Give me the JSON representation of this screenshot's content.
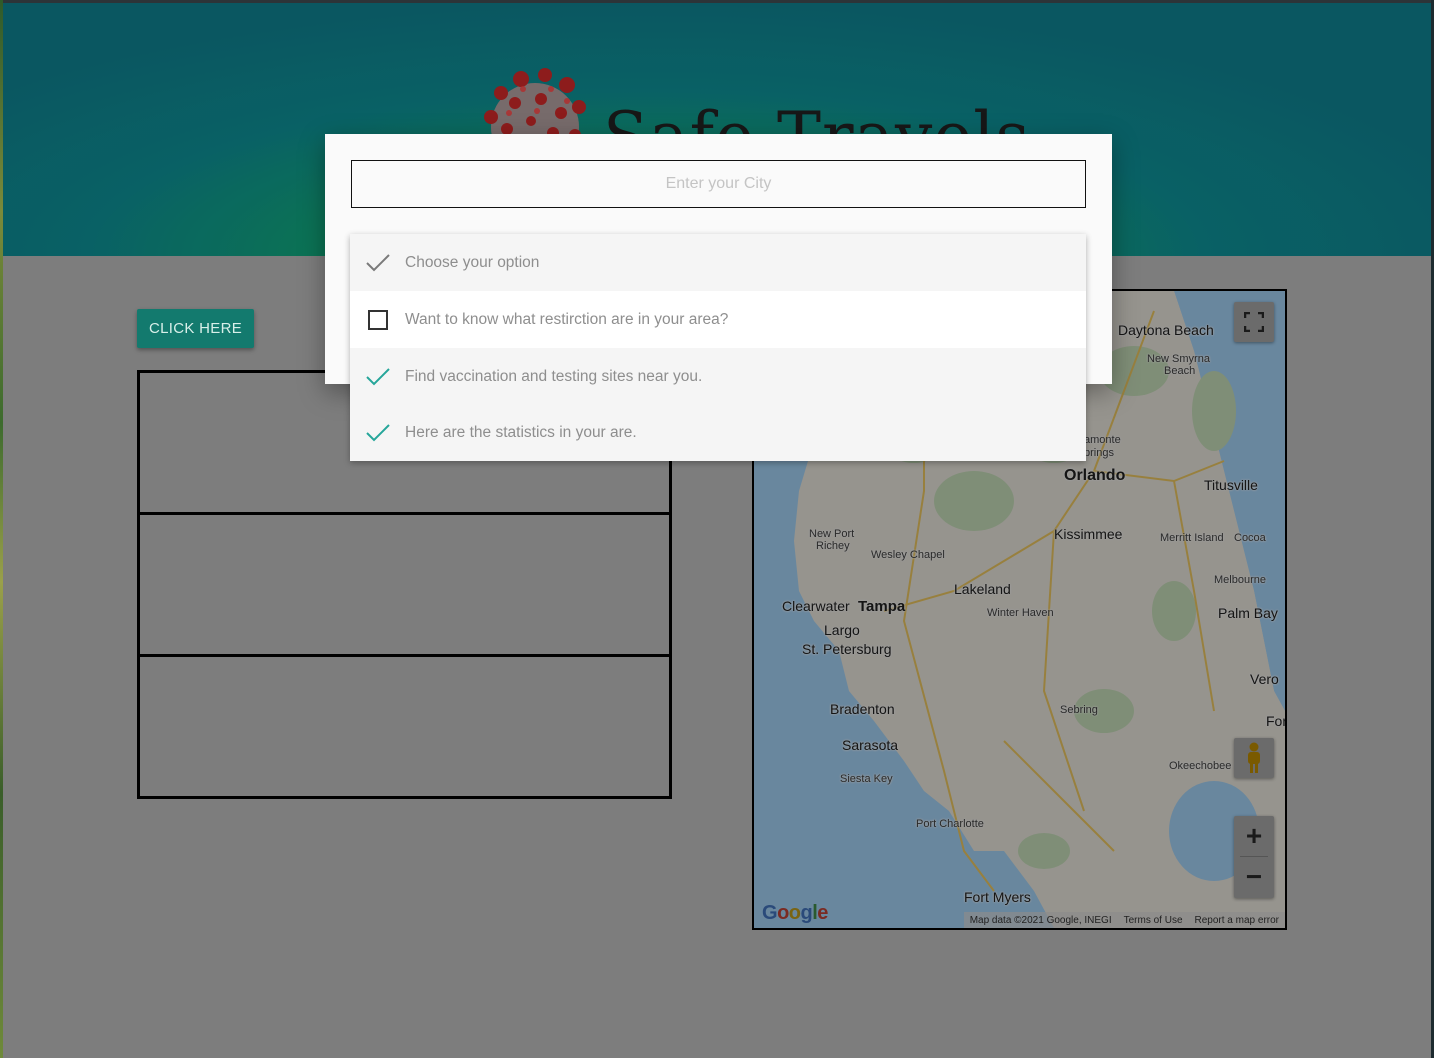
{
  "header": {
    "title": "Safe Travels",
    "logo": "coronavirus-image"
  },
  "main": {
    "click_button_label": "CLICK HERE",
    "info_boxes": [
      "",
      "",
      ""
    ]
  },
  "modal": {
    "city_input": {
      "placeholder": "Enter your City",
      "value": ""
    },
    "dropdown": {
      "options": [
        {
          "label": "Choose your option",
          "state": "selected-header",
          "icon": "checkmark-icon"
        },
        {
          "label": "Want to know what restirction are in your area?",
          "state": "unchecked",
          "icon": "checkbox-icon"
        },
        {
          "label": "Find vaccination and testing sites near you.",
          "state": "checked",
          "icon": "checkmark-icon"
        },
        {
          "label": "Here are the statistics in your are.",
          "state": "checked",
          "icon": "checkmark-icon"
        }
      ]
    }
  },
  "map": {
    "labels": {
      "daytona": "Daytona Beach",
      "new_smyrna": "New Smyrna",
      "beach": "Beach",
      "altamonte": "amonte",
      "springs": "prings",
      "orlando": "Orlando",
      "titusville": "Titusville",
      "new_port": "New Port",
      "richey": "Richey",
      "wesley": "Wesley Chapel",
      "kissimmee": "Kissimmee",
      "merritt": "Merritt Island",
      "cocoa": "Cocoa",
      "lakeland": "Lakeland",
      "melbourne": "Melbourne",
      "clearwater": "Clearwater",
      "tampa": "Tampa",
      "winter_haven": "Winter Haven",
      "palm_bay": "Palm Bay",
      "largo": "Largo",
      "st_pete": "St. Petersburg",
      "vero": "Vero",
      "bradenton": "Bradenton",
      "sebring": "Sebring",
      "fort": "For",
      "sarasota": "Sarasota",
      "siesta": "Siesta Key",
      "okeechobee": "Okeechobee",
      "port_charlotte": "Port Charlotte",
      "fort_myers": "Fort Myers"
    },
    "google": "Google",
    "footer": {
      "map_data": "Map data ©2021 Google, INEGI",
      "terms": "Terms of Use",
      "report": "Report a map error"
    },
    "controls": {
      "zoom_in": "+",
      "zoom_out": "−"
    }
  },
  "colors": {
    "accent": "#137a6e",
    "check": "#26a69a",
    "overlay": "#7d7d7d"
  }
}
